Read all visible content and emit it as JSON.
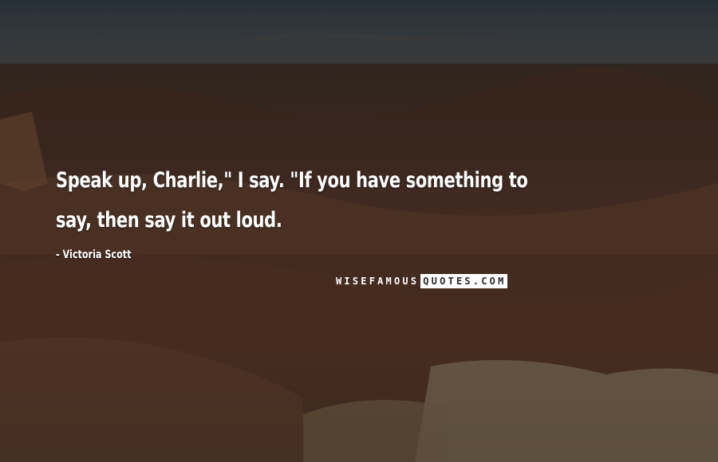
{
  "quote": {
    "text": "Speak up, Charlie,\" I say. \"If you have something to say, then say it out loud.",
    "author": "- Victoria Scott"
  },
  "watermark": {
    "left": "WISEFAMOUS",
    "right": "QUOTES.COM"
  },
  "colors": {
    "text": "#ffffff",
    "overlay": "#2a1a14"
  }
}
